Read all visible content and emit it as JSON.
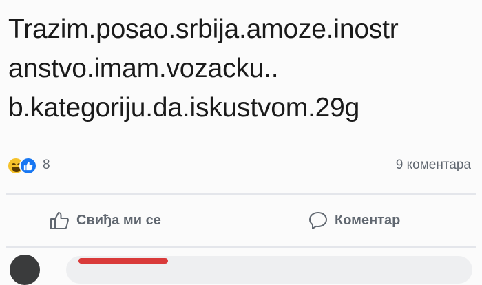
{
  "post": {
    "lines": [
      "Trazim.posao.srbija.amoze.inostr",
      "anstvo.imam.vozacku..",
      "b.kategoriju.da.iskustvom.29g"
    ]
  },
  "reactions": {
    "icons": [
      "haha-emoji-icon",
      "like-reaction-icon"
    ],
    "count": "8",
    "comments_label": "9 коментара"
  },
  "actions": {
    "like": {
      "label": "Свиђа ми се",
      "icon": "thumbs-up-icon"
    },
    "comment": {
      "label": "Коментар",
      "icon": "comment-bubble-icon"
    }
  }
}
